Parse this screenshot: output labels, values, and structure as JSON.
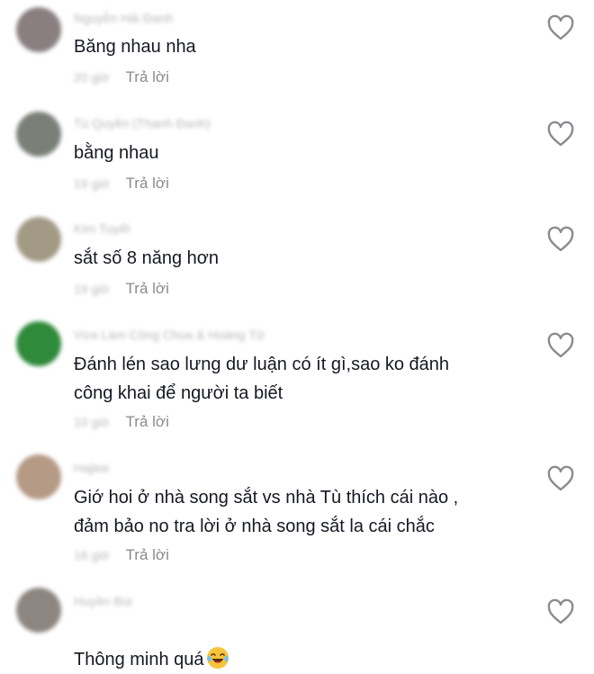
{
  "colors": {
    "text": "#161823",
    "muted": "#8a8b91",
    "blurred": "#b9b9bd",
    "icon": "#8a8b91"
  },
  "comments": [
    {
      "author": "Nguyễn Hải Đanh",
      "text": "Băng nhau nha",
      "time": "20 giờ",
      "reply_label": "Trả lời",
      "avatar_color": "#8a7f80",
      "like_icon": "heart-outline-icon"
    },
    {
      "author": "Tú Quyền (Thanh Đanh)",
      "text": "bằng nhau",
      "time": "19 giờ",
      "reply_label": "Trả lời",
      "avatar_color": "#7a8078",
      "like_icon": "heart-outline-icon"
    },
    {
      "author": "Kim Tuyết",
      "text": "sắt số 8 năng hơn",
      "time": "19 giờ",
      "reply_label": "Trả lời",
      "avatar_color": "#a39a86",
      "like_icon": "heart-outline-icon"
    },
    {
      "author": "Vừa Làm Công Chúa & Hoàng Tử",
      "text": "Đánh lén sao lưng dư luận có ít gì,sao ko đánh\ncông khai để người ta biết",
      "time": "10 giờ",
      "reply_label": "Trả lời",
      "avatar_color": "#2f8a3b",
      "like_icon": "heart-outline-icon"
    },
    {
      "author": "Hajlee",
      "text": "Giớ hoi ở nhà song sắt vs nhà Tù thích cái nào ,\nđảm bảo no tra lời ở nhà song sắt la cái chắc",
      "time": "16 giờ",
      "reply_label": "Trả lời",
      "avatar_color": "#b59a86",
      "like_icon": "heart-outline-icon"
    },
    {
      "author": "Huyền Bùi",
      "text": "Thông minh quá",
      "time": "",
      "reply_label": "",
      "avatar_color": "#8d8680",
      "like_icon": "heart-outline-icon",
      "emoji": "laughing-tears-emoji"
    }
  ]
}
